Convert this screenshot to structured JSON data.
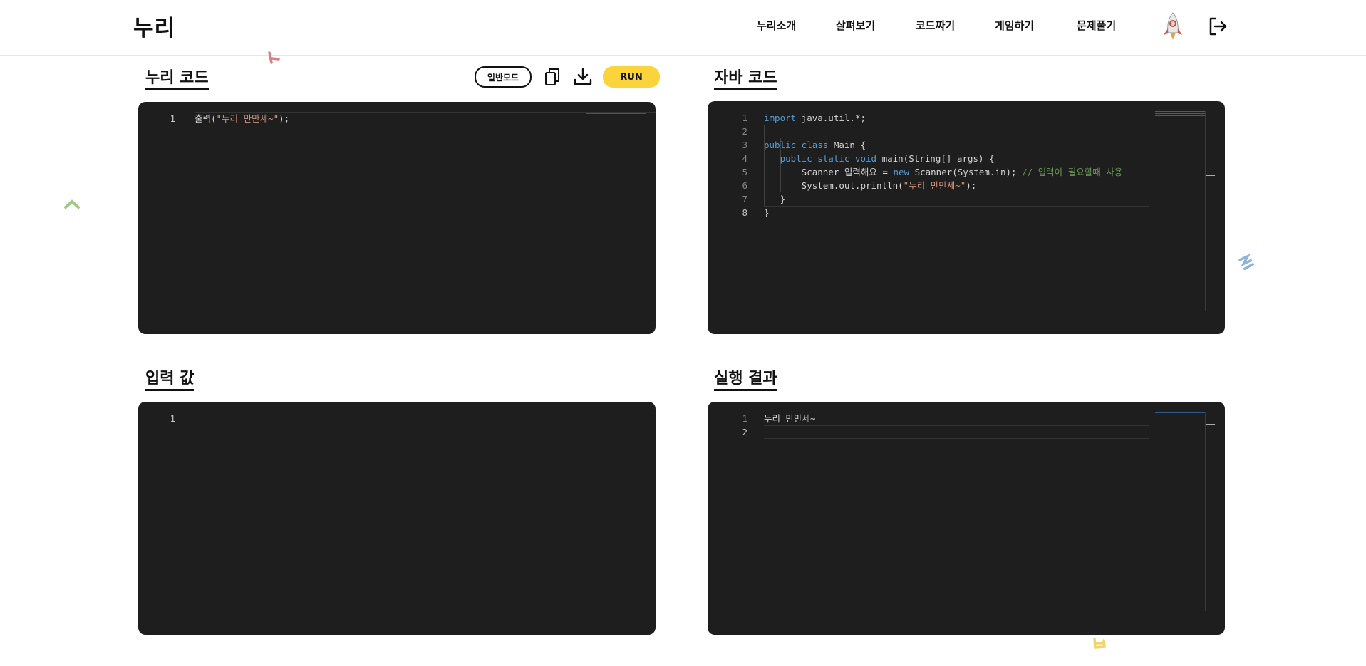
{
  "header": {
    "logo": "누리",
    "nav": [
      "누리소개",
      "살펴보기",
      "코드짜기",
      "게임하기",
      "문제풀기"
    ]
  },
  "sections": {
    "nuri_code": "누리 코드",
    "java_code": "자바 코드",
    "input": "입력 값",
    "result": "실행 결과"
  },
  "toolbar": {
    "mode_label": "일반모드",
    "run_label": "RUN"
  },
  "nuri_editor": {
    "lines": [
      {
        "n": "1",
        "parts": [
          {
            "t": "출력(",
            "c": "plain"
          },
          {
            "t": "\"누리 만만세~\"",
            "c": "str"
          },
          {
            "t": ");",
            "c": "plain"
          }
        ]
      }
    ]
  },
  "java_editor": {
    "lines": [
      {
        "n": "1",
        "parts": [
          {
            "t": "import",
            "c": "kw"
          },
          {
            "t": " java.util.*;",
            "c": "plain"
          }
        ]
      },
      {
        "n": "2",
        "parts": []
      },
      {
        "n": "3",
        "parts": [
          {
            "t": "public class",
            "c": "kw"
          },
          {
            "t": " Main {",
            "c": "plain"
          }
        ]
      },
      {
        "n": "4",
        "parts": [
          {
            "t": "   ",
            "c": "plain"
          },
          {
            "t": "public static void",
            "c": "kw"
          },
          {
            "t": " main(String[] args) {",
            "c": "plain"
          }
        ]
      },
      {
        "n": "5",
        "parts": [
          {
            "t": "       Scanner 입력해요 = ",
            "c": "plain"
          },
          {
            "t": "new",
            "c": "kw"
          },
          {
            "t": " Scanner(System.in); ",
            "c": "plain"
          },
          {
            "t": "// 입력이 필요할때 사용",
            "c": "cm"
          }
        ]
      },
      {
        "n": "6",
        "parts": [
          {
            "t": "       System.out.println(",
            "c": "plain"
          },
          {
            "t": "\"누리 만만세~\"",
            "c": "str"
          },
          {
            "t": ");",
            "c": "plain"
          }
        ]
      },
      {
        "n": "7",
        "parts": [
          {
            "t": "   }",
            "c": "plain"
          }
        ]
      },
      {
        "n": "8",
        "parts": [
          {
            "t": "}",
            "c": "plain"
          }
        ]
      }
    ]
  },
  "input_editor": {
    "lines": [
      {
        "n": "1",
        "parts": []
      }
    ]
  },
  "result_editor": {
    "lines": [
      {
        "n": "1",
        "parts": [
          {
            "t": "누리 만만세~",
            "c": "plain"
          }
        ]
      },
      {
        "n": "2",
        "parts": []
      }
    ]
  },
  "colors": {
    "editor_bg": "#1e1e1e",
    "run_button": "#fbd33a",
    "keyword": "#569cd6",
    "string": "#ce9178",
    "comment": "#6a9955"
  },
  "icons": {
    "copy": "copy-icon",
    "download": "download-icon",
    "logout": "logout-icon",
    "avatar": "rocket-avatar-icon"
  }
}
